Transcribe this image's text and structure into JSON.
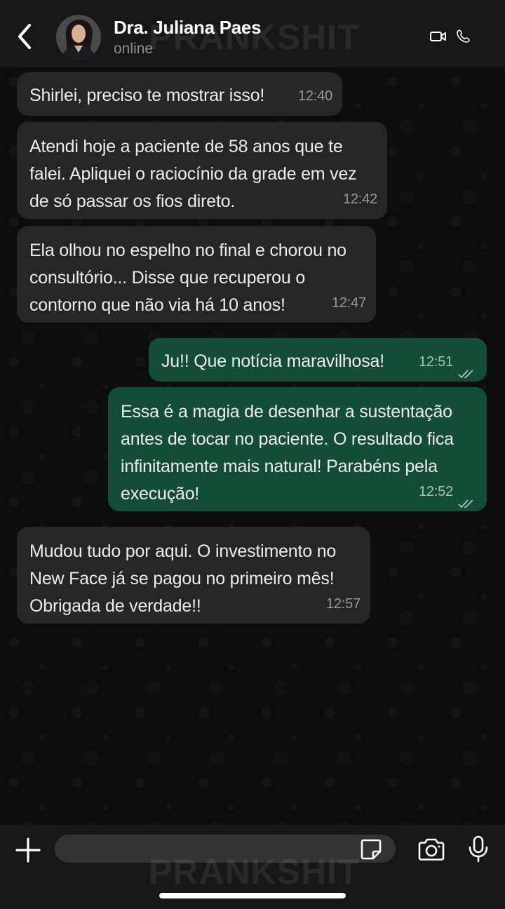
{
  "header": {
    "contact_name": "Dra. Juliana Paes",
    "status": "online",
    "watermark": "PRANKSHIT"
  },
  "messages": [
    {
      "direction": "in",
      "text": "Shirlei, preciso te mostrar isso!",
      "time": "12:40"
    },
    {
      "direction": "in",
      "text": "Atendi hoje a paciente de 58 anos que te falei. Apliquei o raciocínio da grade em vez de só passar os fios direto.",
      "time": "12:42"
    },
    {
      "direction": "in",
      "text": "Ela olhou no espelho no final e chorou no consultório... Disse que recuperou o contorno que não via há 10 anos!",
      "time": "12:47"
    },
    {
      "direction": "out",
      "text": "Ju!! Que notícia maravilhosa!",
      "time": "12:51",
      "status": "read"
    },
    {
      "direction": "out",
      "text": "Essa é a magia de desenhar a sustentação antes de tocar no paciente. O resultado fica infinitamente mais natural! Parabéns pela execução!",
      "time": "12:52",
      "status": "read"
    },
    {
      "direction": "in",
      "text": "Mudou tudo por aqui. O investimento no New Face já se pagou no primeiro mês! Obrigada de verdade!!",
      "time": "12:57"
    }
  ],
  "input": {
    "placeholder": "",
    "watermark": "PRANKSHIT"
  },
  "colors": {
    "incoming_bubble": "#262626",
    "outgoing_bubble": "#144d37",
    "header_bg": "#171717",
    "chat_bg": "#0c0c0c"
  },
  "icons": [
    "back-arrow-icon",
    "video-call-icon",
    "phone-icon",
    "plus-icon",
    "sticker-icon",
    "camera-icon",
    "mic-icon",
    "double-check-icon"
  ]
}
